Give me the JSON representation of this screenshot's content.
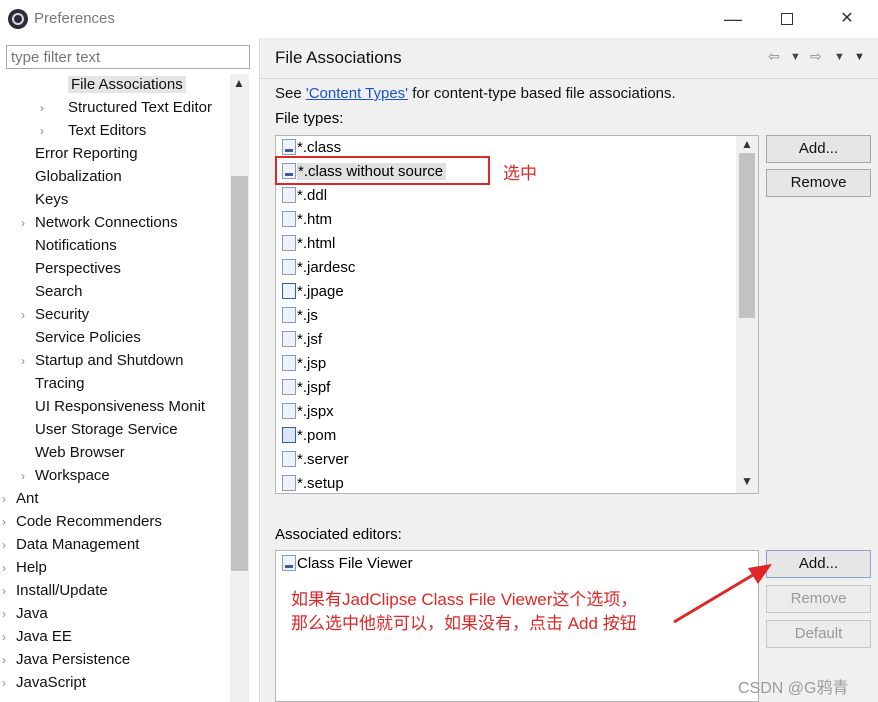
{
  "window": {
    "title": "Preferences",
    "icon": "eclipse-icon",
    "min_glyph": "—",
    "close_glyph": "✕"
  },
  "filter": {
    "placeholder": "type filter text"
  },
  "tree": [
    {
      "label": "File Associations",
      "level": 3,
      "chev": "",
      "selected": true
    },
    {
      "label": "Structured Text Editor",
      "level": 3,
      "chev": "›"
    },
    {
      "label": "Text Editors",
      "level": 3,
      "chev": "›"
    },
    {
      "label": "Error Reporting",
      "level": 2,
      "chev": ""
    },
    {
      "label": "Globalization",
      "level": 2,
      "chev": ""
    },
    {
      "label": "Keys",
      "level": 2,
      "chev": ""
    },
    {
      "label": "Network Connections",
      "level": 2,
      "chev": "›"
    },
    {
      "label": "Notifications",
      "level": 2,
      "chev": ""
    },
    {
      "label": "Perspectives",
      "level": 2,
      "chev": ""
    },
    {
      "label": "Search",
      "level": 2,
      "chev": ""
    },
    {
      "label": "Security",
      "level": 2,
      "chev": "›"
    },
    {
      "label": "Service Policies",
      "level": 2,
      "chev": ""
    },
    {
      "label": "Startup and Shutdown",
      "level": 2,
      "chev": "›"
    },
    {
      "label": "Tracing",
      "level": 2,
      "chev": ""
    },
    {
      "label": "UI Responsiveness Monit",
      "level": 2,
      "chev": ""
    },
    {
      "label": "User Storage Service",
      "level": 2,
      "chev": ""
    },
    {
      "label": "Web Browser",
      "level": 2,
      "chev": ""
    },
    {
      "label": "Workspace",
      "level": 2,
      "chev": "›"
    },
    {
      "label": "Ant",
      "level": 1,
      "chev": "›"
    },
    {
      "label": "Code Recommenders",
      "level": 1,
      "chev": "›"
    },
    {
      "label": "Data Management",
      "level": 1,
      "chev": "›"
    },
    {
      "label": "Help",
      "level": 1,
      "chev": "›"
    },
    {
      "label": "Install/Update",
      "level": 1,
      "chev": "›"
    },
    {
      "label": "Java",
      "level": 1,
      "chev": "›"
    },
    {
      "label": "Java EE",
      "level": 1,
      "chev": "›"
    },
    {
      "label": "Java Persistence",
      "level": 1,
      "chev": "›"
    },
    {
      "label": "JavaScript",
      "level": 1,
      "chev": "›"
    }
  ],
  "page": {
    "title": "File Associations",
    "desc_prefix": "See ",
    "desc_link": "'Content Types'",
    "desc_suffix": " for content-type based file associations.",
    "file_types_label": "File types:",
    "associated_editors_label": "Associated editors:"
  },
  "nav": {
    "back": "⇦",
    "forward": "⇨",
    "dropdown": "▼",
    "menu": "▼"
  },
  "file_types": [
    {
      "name": "*.class",
      "icon": "class-file-icon",
      "kind": "cls"
    },
    {
      "name": "*.class without source",
      "icon": "class-file-icon",
      "kind": "cls",
      "selected": true
    },
    {
      "name": "*.ddl",
      "icon": "ddl-file-icon",
      "kind": "doc"
    },
    {
      "name": "*.htm",
      "icon": "html-file-icon",
      "kind": "doc"
    },
    {
      "name": "*.html",
      "icon": "html-file-icon",
      "kind": "doc"
    },
    {
      "name": "*.jardesc",
      "icon": "jardesc-file-icon",
      "kind": "doc"
    },
    {
      "name": "*.jpage",
      "icon": "java-page-icon",
      "kind": "j"
    },
    {
      "name": "*.js",
      "icon": "js-file-icon",
      "kind": "doc"
    },
    {
      "name": "*.jsf",
      "icon": "jsf-file-icon",
      "kind": "doc"
    },
    {
      "name": "*.jsp",
      "icon": "jsp-file-icon",
      "kind": "doc"
    },
    {
      "name": "*.jspf",
      "icon": "jsp-file-icon",
      "kind": "doc"
    },
    {
      "name": "*.jspx",
      "icon": "jsp-file-icon",
      "kind": "doc"
    },
    {
      "name": "*.pom",
      "icon": "maven-pom-icon",
      "kind": "pom"
    },
    {
      "name": "*.server",
      "icon": "server-file-icon",
      "kind": "doc"
    },
    {
      "name": "*.setup",
      "icon": "setup-file-icon",
      "kind": "doc"
    }
  ],
  "associated_editors": [
    {
      "name": "Class File Viewer",
      "icon": "class-file-icon",
      "kind": "cls"
    }
  ],
  "buttons": {
    "ft_add": "Add...",
    "ft_remove": "Remove",
    "ae_add": "Add...",
    "ae_remove": "Remove",
    "ae_default": "Default"
  },
  "annotations": {
    "selected_note": "选中",
    "long_note_line1": "如果有JadClipse Class File Viewer这个选项，",
    "long_note_line2": "那么选中他就可以，如果没有，点击 Add 按钮",
    "color": "#e02626"
  },
  "watermark": "CSDN @G鸦青",
  "scroll": {
    "up": "▲",
    "down": "▼"
  }
}
